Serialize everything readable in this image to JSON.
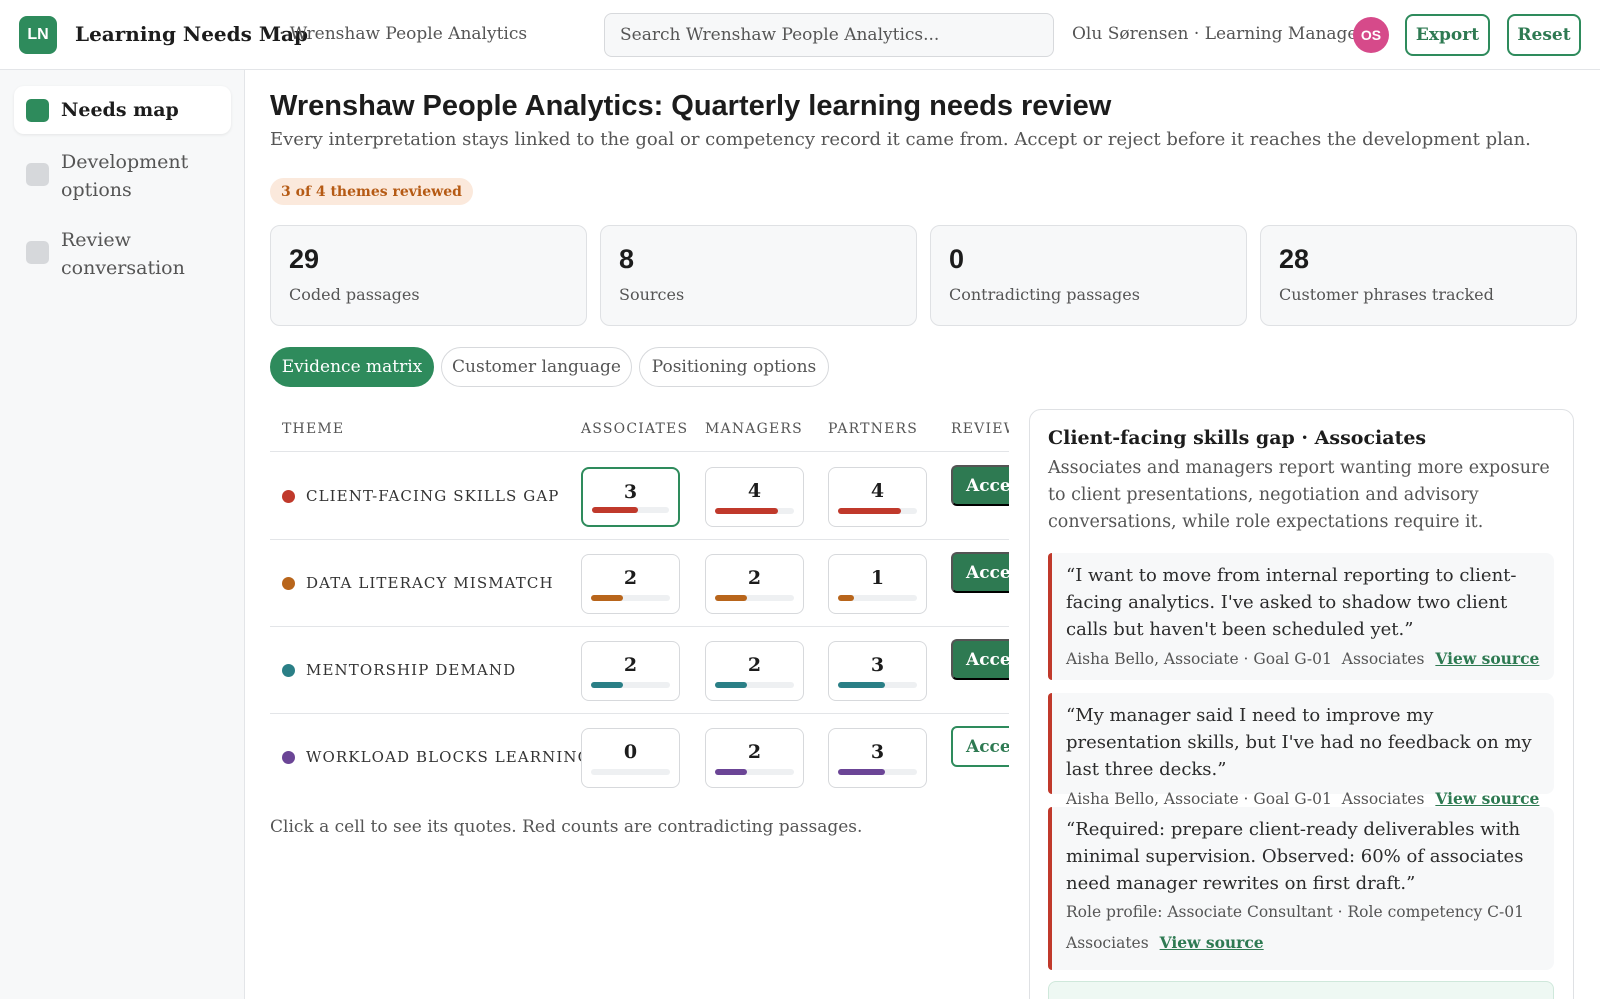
{
  "app": {
    "logo_text": "LN",
    "title": "Learning Needs Map",
    "workspace": "· Wrenshaw People Analytics",
    "search_placeholder": "Search Wrenshaw People Analytics...",
    "user_line": "Olu Sørensen · Learning Manager",
    "avatar_initials": "OS",
    "export_label": "Export",
    "reset_label": "Reset"
  },
  "sidebar": {
    "items": [
      {
        "label": "Needs map",
        "active": true
      },
      {
        "label": "Development options",
        "active": false
      },
      {
        "label": "Review conversation",
        "active": false
      }
    ]
  },
  "main": {
    "title": "Wrenshaw People Analytics: Quarterly learning needs review",
    "description": "Every interpretation stays linked to the goal or competency record it came from. Accept or reject before it reaches the development plan.",
    "progress_badge": "3 of 4 themes reviewed",
    "stats": [
      {
        "value": "29",
        "label": "Coded passages"
      },
      {
        "value": "8",
        "label": "Sources"
      },
      {
        "value": "0",
        "label": "Contradicting passages"
      },
      {
        "value": "28",
        "label": "Customer phrases tracked"
      }
    ],
    "tabs": [
      {
        "label": "Evidence matrix",
        "active": true
      },
      {
        "label": "Customer language",
        "active": false
      },
      {
        "label": "Positioning options",
        "active": false
      }
    ]
  },
  "matrix": {
    "headers": {
      "theme": "THEME",
      "associates": "ASSOCIATES",
      "managers": "MANAGERS",
      "partners": "PARTNERS",
      "review": "REVIEW"
    },
    "max_count": 5,
    "rows": [
      {
        "theme": "CLIENT-FACING SKILLS GAP",
        "color": "#c0392b",
        "counts": [
          3,
          4,
          4
        ],
        "review_label": "Accept",
        "review_state": "filled",
        "selected_col": 0
      },
      {
        "theme": "DATA LITERACY MISMATCH",
        "color": "#b8651b",
        "counts": [
          2,
          2,
          1
        ],
        "review_label": "Accept",
        "review_state": "filled",
        "selected_col": -1
      },
      {
        "theme": "MENTORSHIP DEMAND",
        "color": "#2a7f86",
        "counts": [
          2,
          2,
          3
        ],
        "review_label": "Accept",
        "review_state": "filled",
        "selected_col": -1
      },
      {
        "theme": "WORKLOAD BLOCKS LEARNING",
        "color": "#6b4596",
        "counts": [
          0,
          2,
          3
        ],
        "review_label": "Accept",
        "review_state": "outline",
        "selected_col": -1
      }
    ],
    "note": "Click a cell to see its quotes. Red counts are contradicting passages."
  },
  "detail": {
    "title": "Client-facing skills gap · Associates",
    "description": "Associates and managers report wanting more exposure to client presentations, negotiation and advisory conversations, while role expectations require it.",
    "quotes": [
      {
        "text": "“I want to move from internal reporting to client-facing analytics. I've asked to shadow two client calls but haven't been scheduled yet.”",
        "source": "Aisha Bello, Associate · Goal G-01",
        "group": "Associates",
        "link": "View source"
      },
      {
        "text": "“My manager said I need to improve my presentation skills, but I've had no feedback on my last three decks.”",
        "source": "Aisha Bello, Associate · Goal G-01",
        "group": "Associates",
        "link": "View source"
      },
      {
        "text": "“Required: prepare client-ready deliverables with minimal supervision. Observed: 60% of associates need manager rewrites on first draft.”",
        "source": "Role profile: Associate Consultant · Role competency C-01",
        "group": "Associates",
        "link": "View source"
      }
    ]
  }
}
